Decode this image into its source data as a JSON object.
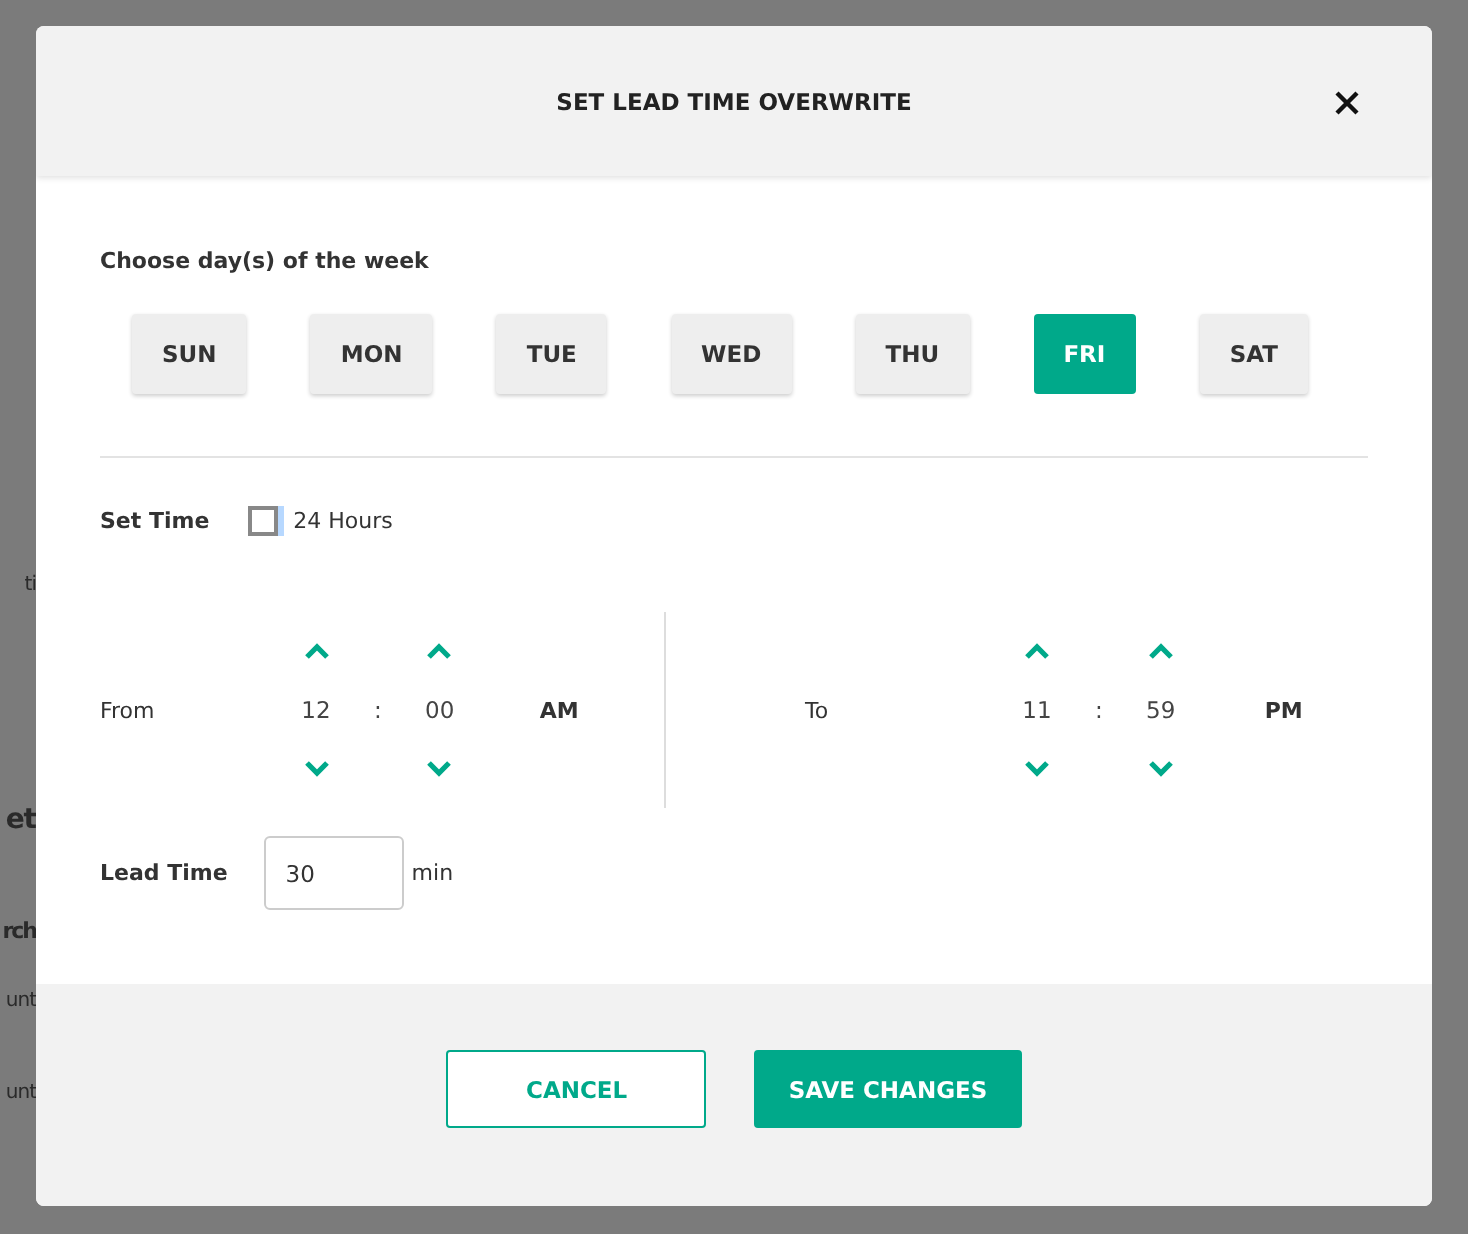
{
  "background": {
    "fragments": [
      {
        "text": "ti",
        "kind": "plain"
      },
      {
        "text": "et",
        "kind": "heading"
      },
      {
        "text": "rch",
        "kind": "subheading"
      },
      {
        "text": "unt",
        "kind": "plain"
      },
      {
        "text": "unt",
        "kind": "plain"
      }
    ]
  },
  "dialog": {
    "title": "SET LEAD TIME OVERWRITE",
    "days_label": "Choose day(s) of the week",
    "days": [
      {
        "label": "SUN",
        "selected": false
      },
      {
        "label": "MON",
        "selected": false
      },
      {
        "label": "TUE",
        "selected": false
      },
      {
        "label": "WED",
        "selected": false
      },
      {
        "label": "THU",
        "selected": false
      },
      {
        "label": "FRI",
        "selected": true
      },
      {
        "label": "SAT",
        "selected": false
      }
    ],
    "set_time": {
      "label": "Set Time",
      "all_day": {
        "label": "24 Hours",
        "checked": false
      }
    },
    "from": {
      "label": "From",
      "hour": "12",
      "separator": ":",
      "minute": "00",
      "meridiem": "AM"
    },
    "to": {
      "label": "To",
      "hour": "11",
      "separator": ":",
      "minute": "59",
      "meridiem": "PM"
    },
    "lead_time": {
      "label": "Lead Time",
      "value": "30",
      "unit": "min"
    },
    "buttons": [
      {
        "label": "CANCEL",
        "kind": "secondary"
      },
      {
        "label": "SAVE CHANGES",
        "kind": "primary"
      }
    ]
  }
}
